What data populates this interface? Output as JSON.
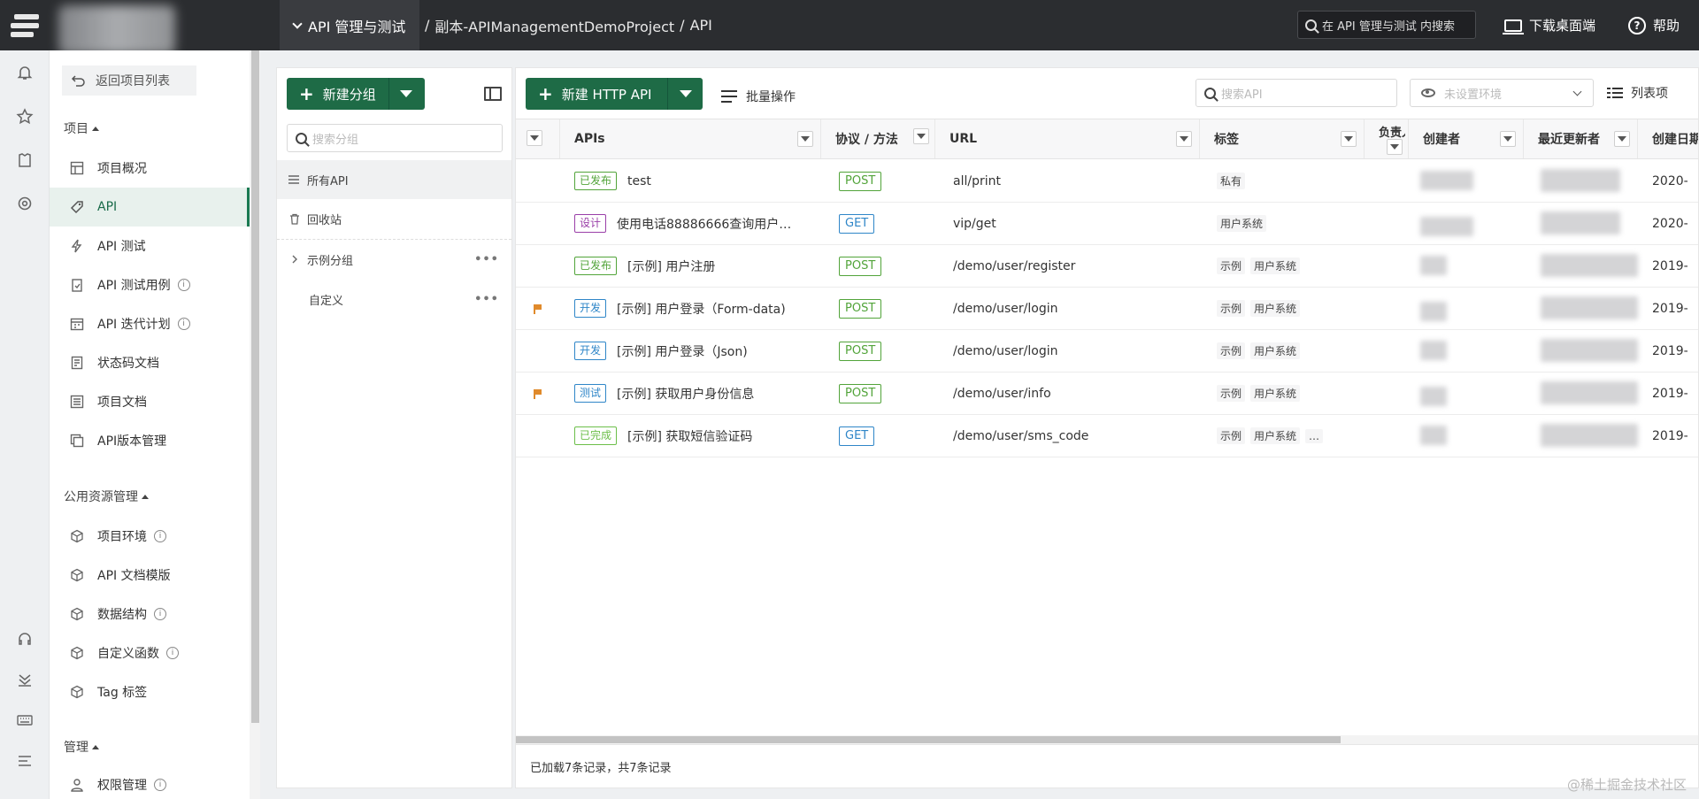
{
  "topbar": {
    "project_switch": "API 管理与测试",
    "breadcrumb": [
      "/",
      "副本-APIManagementDemoProject",
      "/",
      "API"
    ],
    "search_placeholder": "在 API 管理与测试 内搜索",
    "download_label": "下载桌面端",
    "help_label": "帮助"
  },
  "nav": {
    "back_label": "返回项目列表",
    "sections": {
      "project": "项目",
      "public": "公用资源管理",
      "manage": "管理"
    },
    "project_items": [
      "项目概况",
      "API",
      "API 测试",
      "API 测试用例",
      "API 迭代计划",
      "状态码文档",
      "项目文档",
      "API版本管理"
    ],
    "public_items": [
      "项目环境",
      "API 文档模版",
      "数据结构",
      "自定义函数",
      "Tag 标签"
    ],
    "manage_items": [
      "权限管理"
    ],
    "info_mark": "i"
  },
  "group_panel": {
    "new_group_label": "新建分组",
    "search_placeholder": "搜索分组",
    "tree": [
      "所有API",
      "回收站",
      "示例分组",
      "自定义"
    ]
  },
  "main_panel": {
    "new_api_label": "新建 HTTP API",
    "batch_label": "批量操作",
    "search_placeholder": "搜索API",
    "env_placeholder": "未设置环境",
    "columns_label": "列表项",
    "columns": [
      "APIs",
      "协议 / 方法",
      "URL",
      "标签",
      "负责人",
      "创建者",
      "最近更新者",
      "创建日期"
    ],
    "rows": [
      {
        "flag": false,
        "status": "已发布",
        "status_color": "#52a43a",
        "name": "test",
        "method": "POST",
        "method_color": "#52a43a",
        "url": "all/print",
        "tags": [
          "私有"
        ],
        "date": "2020-"
      },
      {
        "flag": false,
        "status": "设计",
        "status_color": "#9a3fa8",
        "name": "使用电话88886666查询用户…",
        "method": "GET",
        "method_color": "#2f86c8",
        "url": "vip/get",
        "tags": [
          "用户系统"
        ],
        "date": "2020-"
      },
      {
        "flag": false,
        "status": "已发布",
        "status_color": "#52a43a",
        "name": "[示例] 用户注册",
        "method": "POST",
        "method_color": "#52a43a",
        "url": "/demo/user/register",
        "tags": [
          "示例",
          "用户系统"
        ],
        "date": "2019-"
      },
      {
        "flag": true,
        "status": "开发",
        "status_color": "#2f86c8",
        "name": "[示例] 用户登录（Form-data)",
        "method": "POST",
        "method_color": "#52a43a",
        "url": "/demo/user/login",
        "tags": [
          "示例",
          "用户系统"
        ],
        "date": "2019-"
      },
      {
        "flag": false,
        "status": "开发",
        "status_color": "#2f86c8",
        "name": "[示例] 用户登录（Json)",
        "method": "POST",
        "method_color": "#52a43a",
        "url": "/demo/user/login",
        "tags": [
          "示例",
          "用户系统"
        ],
        "date": "2019-"
      },
      {
        "flag": true,
        "status": "测试",
        "status_color": "#2f86c8",
        "name": "[示例] 获取用户身份信息",
        "method": "POST",
        "method_color": "#52a43a",
        "url": "/demo/user/info",
        "tags": [
          "示例",
          "用户系统"
        ],
        "date": "2019-"
      },
      {
        "flag": false,
        "status": "已完成",
        "status_color": "#6cbf4a",
        "name": "[示例] 获取短信验证码",
        "method": "GET",
        "method_color": "#2f86c8",
        "url": "/demo/user/sms_code",
        "tags": [
          "示例",
          "用户系统",
          "…"
        ],
        "date": "2019-"
      }
    ],
    "footer": "已加载7条记录，共7条记录"
  },
  "watermark": "@稀土掘金技术社区",
  "colors": {
    "brand_green": "#1e6b46",
    "topbar": "#2b2d30"
  }
}
